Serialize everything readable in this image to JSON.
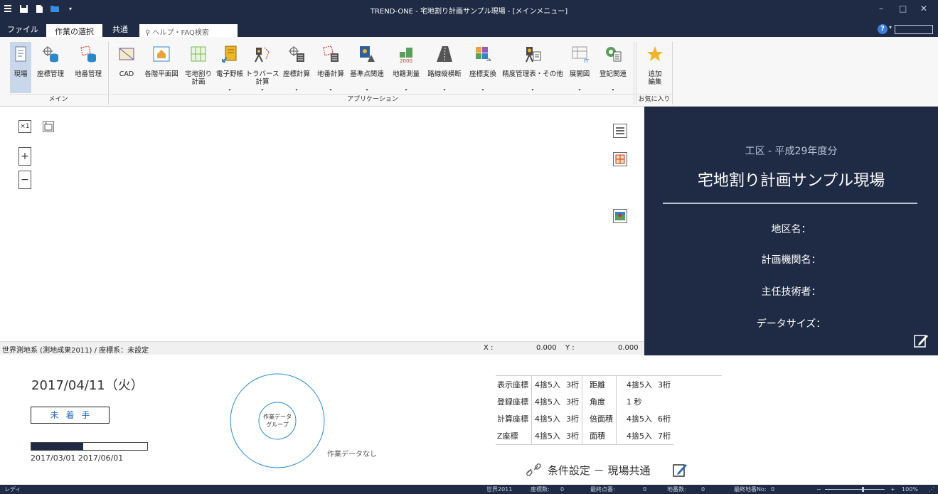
{
  "window": {
    "title": "TREND-ONE - 宅地割り計画サンプル現場 - [メインメニュー]"
  },
  "tabs": [
    {
      "label": "ファイル"
    },
    {
      "label": "作業の選択"
    },
    {
      "label": "共通"
    }
  ],
  "help": {
    "search_placeholder": "ヘルプ・FAQ検索",
    "help_symbol": "?"
  },
  "ribbon": {
    "groups": {
      "main": "メイン",
      "apps": "アプリケーション",
      "favorites": "お気に入り"
    },
    "main_buttons": [
      {
        "line1": "現場",
        "line2": ""
      },
      {
        "line1": "座標管理",
        "line2": ""
      },
      {
        "line1": "地番管理",
        "line2": ""
      }
    ],
    "app_buttons": [
      {
        "line1": "CAD",
        "line2": ""
      },
      {
        "line1": "各階平面図",
        "line2": ""
      },
      {
        "line1": "宅地割り",
        "line2": "計画"
      },
      {
        "line1": "電子野帳",
        "line2": ""
      },
      {
        "line1": "トラバース",
        "line2": "計算"
      },
      {
        "line1": "座標計算",
        "line2": ""
      },
      {
        "line1": "地番計算",
        "line2": ""
      },
      {
        "line1": "基準点関連",
        "line2": ""
      },
      {
        "line1": "地籍測量",
        "line2": ""
      },
      {
        "line1": "路線縦横断",
        "line2": ""
      },
      {
        "line1": "座標変換",
        "line2": ""
      },
      {
        "line1": "精度管理表・その他",
        "line2": ""
      },
      {
        "line1": "展開図",
        "line2": ""
      },
      {
        "line1": "登記関連",
        "line2": ""
      }
    ],
    "fav_button": {
      "line1": "追加",
      "line2": "編集"
    },
    "icon_2000": "2000",
    "icon_m": "m"
  },
  "map": {
    "zoom_in": "+",
    "zoom_out": "−",
    "scale_label": "×1"
  },
  "coord": {
    "system": "世界測地系 (測地成果2011) / 座標系：未設定",
    "x_label": "X :",
    "x_value": "0.000",
    "y_label": "Y :",
    "y_value": "0.000"
  },
  "site": {
    "sub": "工区 - 平成29年度分",
    "name": "宅地割り計画サンプル現場",
    "fields": [
      "地区名：",
      "計画機関名：",
      "主任技術者：",
      "データサイズ："
    ]
  },
  "schedule": {
    "date": "2017/04/11（火）",
    "status": "未着手",
    "progress": 0.45,
    "start": "2017/03/01",
    "end": "2017/06/01"
  },
  "workdata": {
    "center_line1": "作業データ",
    "center_line2": "グループ",
    "empty": "作業データなし"
  },
  "precision": {
    "rows": [
      [
        "表示座標",
        "4捨5入",
        "3桁",
        "距離",
        "4捨5入",
        "3桁"
      ],
      [
        "登録座標",
        "4捨5入",
        "3桁",
        "角度",
        "1 秒",
        ""
      ],
      [
        "計算座標",
        "4捨5入",
        "3桁",
        "倍面積",
        "4捨5入",
        "6桁"
      ],
      [
        "Z座標",
        "4捨5入",
        "3桁",
        "面積",
        "4捨5入",
        "7桁"
      ]
    ],
    "condition": "条件設定 － 現場共通"
  },
  "statusbar": {
    "ready": "レディ",
    "system": "世界2011",
    "coords_label": "座標数:",
    "coords": "0",
    "last_point_label": "最終点番:",
    "last_point": "0",
    "lots_label": "地番数:",
    "lots": "0",
    "last_lot_label": "最終地番No:",
    "last_lot": "0",
    "zoom_minus": "−",
    "zoom_plus": "+",
    "zoom": "100%"
  },
  "colors": {
    "navy": "#1f2a44",
    "accent_blue": "#2a6db5",
    "light_text": "#b8c2d6"
  }
}
